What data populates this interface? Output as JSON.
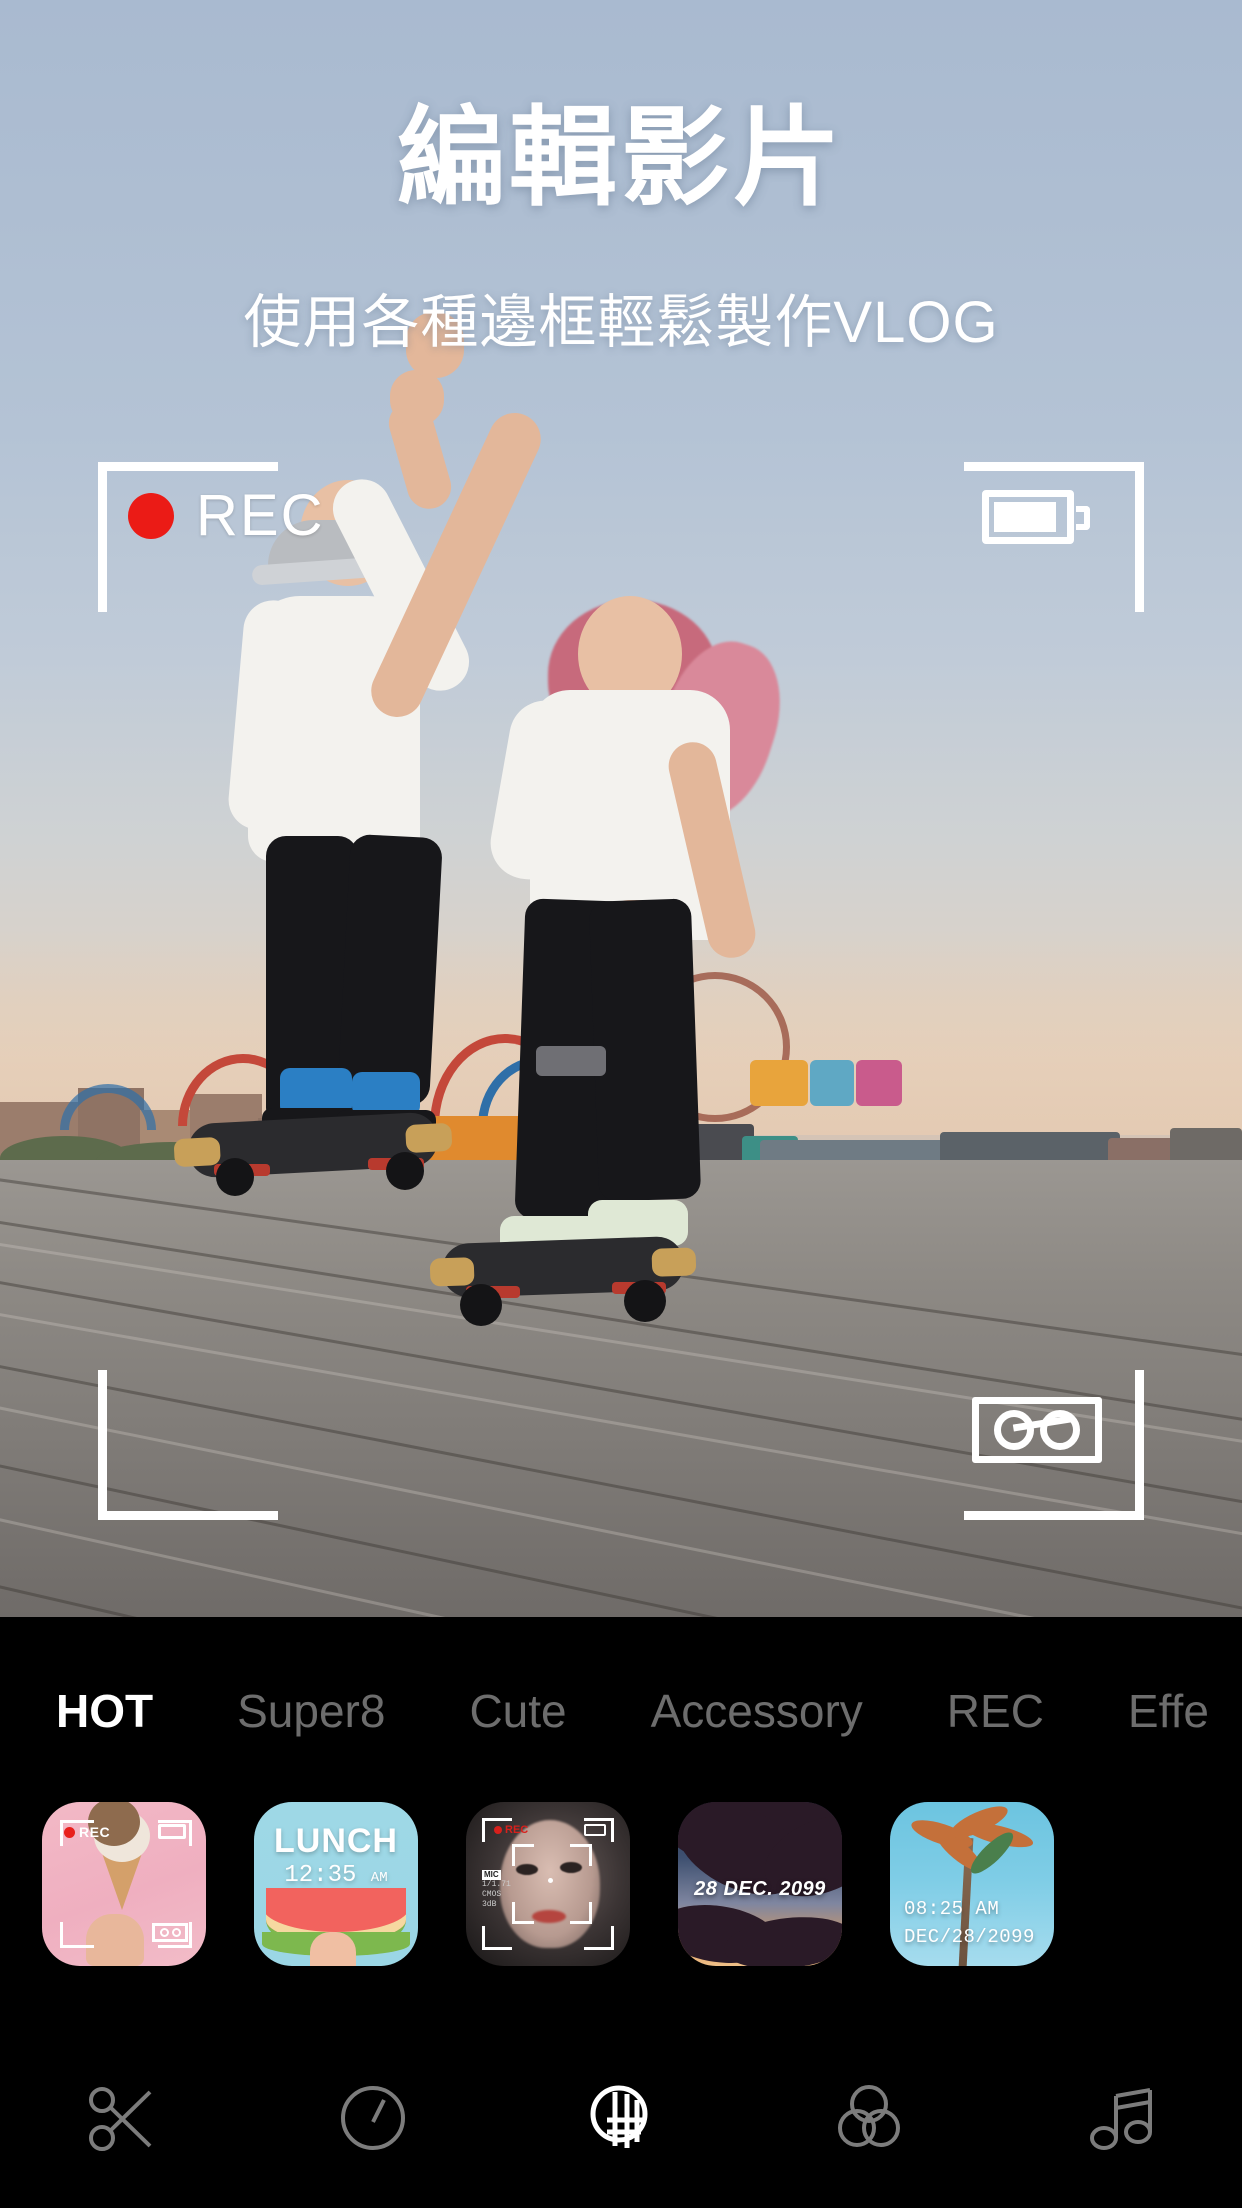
{
  "header": {
    "title": "編輯影片",
    "subtitle": "使用各種邊框輕鬆製作VLOG"
  },
  "viewfinder": {
    "rec_label": "REC",
    "rec_dot_color": "#eb1b16",
    "battery_icon": "battery-full-icon",
    "cassette_icon": "cassette-tape-icon",
    "frame_color": "#ffffff"
  },
  "tabs": [
    {
      "label": "HOT",
      "active": true
    },
    {
      "label": "Super8",
      "active": false
    },
    {
      "label": "Cute",
      "active": false
    },
    {
      "label": "Accessory",
      "active": false
    },
    {
      "label": "REC",
      "active": false
    },
    {
      "label": "Effe",
      "active": false
    }
  ],
  "frames": [
    {
      "name": "rec-pink-icecream",
      "rec_label": "REC",
      "selected": false
    },
    {
      "name": "lunch-watermelon",
      "title": "LUNCH",
      "time": "12:35",
      "meridiem": "AM",
      "selected": false
    },
    {
      "name": "camera-viewfinder-portrait",
      "rec_label": "REC",
      "meta_line1": "MIC",
      "meta_line2": "1/1.71",
      "meta_line3": "CMOS",
      "meta_line4": "3dB",
      "selected": false
    },
    {
      "name": "dusk-palm-date",
      "date": "28 DEC. 2099",
      "selected": false
    },
    {
      "name": "blue-sky-palm-timestamp",
      "time": "08:25 AM",
      "date": "DEC/28/2099",
      "selected": false
    }
  ],
  "toolbar": [
    {
      "name": "trim-icon",
      "label": "Trim",
      "active": false
    },
    {
      "name": "speed-icon",
      "label": "Speed",
      "active": false
    },
    {
      "name": "frames-icon",
      "label": "Frames",
      "active": true
    },
    {
      "name": "filters-icon",
      "label": "Filters",
      "active": false
    },
    {
      "name": "music-icon",
      "label": "Music",
      "active": false
    }
  ],
  "colors": {
    "panel_bg": "#000000",
    "tab_active": "#ffffff",
    "tab_inactive": "#6d6d6d",
    "rec_red": "#eb1b16"
  }
}
